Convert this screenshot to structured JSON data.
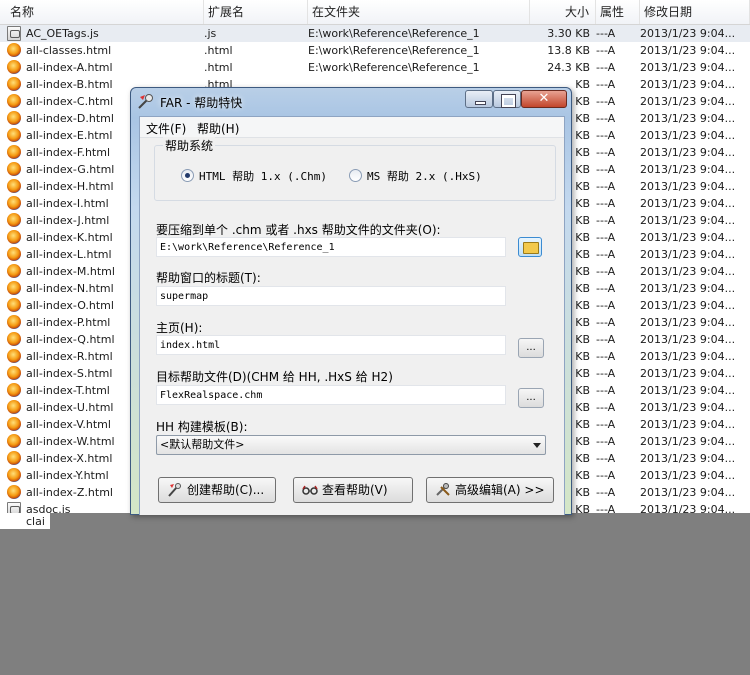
{
  "explorer": {
    "columns": {
      "name": "名称",
      "ext": "扩展名",
      "location": "在文件夹",
      "size": "大小",
      "attr": "属性",
      "date": "修改日期"
    },
    "rows": [
      {
        "name": "AC_OETags.js",
        "ext": ".js",
        "location": "E:\\work\\Reference\\Reference_1",
        "size": "3.30 KB",
        "attr": "---A",
        "date": "2013/1/23 9:04..."
      },
      {
        "name": "all-classes.html",
        "ext": ".html",
        "location": "E:\\work\\Reference\\Reference_1",
        "size": "13.8 KB",
        "attr": "---A",
        "date": "2013/1/23 9:04..."
      },
      {
        "name": "all-index-A.html",
        "ext": ".html",
        "location": "E:\\work\\Reference\\Reference_1",
        "size": "24.3 KB",
        "attr": "---A",
        "date": "2013/1/23 9:04..."
      },
      {
        "name": "all-index-B.html",
        "ext": ".html",
        "location": "",
        "size": "KB",
        "attr": "---A",
        "date": "2013/1/23 9:04..."
      },
      {
        "name": "all-index-C.html",
        "ext": "",
        "location": "",
        "size": "KB",
        "attr": "---A",
        "date": "2013/1/23 9:04..."
      },
      {
        "name": "all-index-D.html",
        "ext": "",
        "location": "",
        "size": "KB",
        "attr": "---A",
        "date": "2013/1/23 9:04..."
      },
      {
        "name": "all-index-E.html",
        "ext": "",
        "location": "",
        "size": "KB",
        "attr": "---A",
        "date": "2013/1/23 9:04..."
      },
      {
        "name": "all-index-F.html",
        "ext": "",
        "location": "",
        "size": "KB",
        "attr": "---A",
        "date": "2013/1/23 9:04..."
      },
      {
        "name": "all-index-G.html",
        "ext": "",
        "location": "",
        "size": "KB",
        "attr": "---A",
        "date": "2013/1/23 9:04..."
      },
      {
        "name": "all-index-H.html",
        "ext": "",
        "location": "",
        "size": "KB",
        "attr": "---A",
        "date": "2013/1/23 9:04..."
      },
      {
        "name": "all-index-I.html",
        "ext": "",
        "location": "",
        "size": "KB",
        "attr": "---A",
        "date": "2013/1/23 9:04..."
      },
      {
        "name": "all-index-J.html",
        "ext": "",
        "location": "",
        "size": "KB",
        "attr": "---A",
        "date": "2013/1/23 9:04..."
      },
      {
        "name": "all-index-K.html",
        "ext": "",
        "location": "",
        "size": "KB",
        "attr": "---A",
        "date": "2013/1/23 9:04..."
      },
      {
        "name": "all-index-L.html",
        "ext": "",
        "location": "",
        "size": "KB",
        "attr": "---A",
        "date": "2013/1/23 9:04..."
      },
      {
        "name": "all-index-M.html",
        "ext": "",
        "location": "",
        "size": "KB",
        "attr": "---A",
        "date": "2013/1/23 9:04..."
      },
      {
        "name": "all-index-N.html",
        "ext": "",
        "location": "",
        "size": "KB",
        "attr": "---A",
        "date": "2013/1/23 9:04..."
      },
      {
        "name": "all-index-O.html",
        "ext": "",
        "location": "",
        "size": "KB",
        "attr": "---A",
        "date": "2013/1/23 9:04..."
      },
      {
        "name": "all-index-P.html",
        "ext": "",
        "location": "",
        "size": "KB",
        "attr": "---A",
        "date": "2013/1/23 9:04..."
      },
      {
        "name": "all-index-Q.html",
        "ext": "",
        "location": "",
        "size": "KB",
        "attr": "---A",
        "date": "2013/1/23 9:04..."
      },
      {
        "name": "all-index-R.html",
        "ext": "",
        "location": "",
        "size": "KB",
        "attr": "---A",
        "date": "2013/1/23 9:04..."
      },
      {
        "name": "all-index-S.html",
        "ext": "",
        "location": "",
        "size": "KB",
        "attr": "---A",
        "date": "2013/1/23 9:04..."
      },
      {
        "name": "all-index-T.html",
        "ext": "",
        "location": "",
        "size": "KB",
        "attr": "---A",
        "date": "2013/1/23 9:04..."
      },
      {
        "name": "all-index-U.html",
        "ext": "",
        "location": "",
        "size": "KB",
        "attr": "---A",
        "date": "2013/1/23 9:04..."
      },
      {
        "name": "all-index-V.html",
        "ext": "",
        "location": "",
        "size": "KB",
        "attr": "---A",
        "date": "2013/1/23 9:04..."
      },
      {
        "name": "all-index-W.html",
        "ext": "",
        "location": "",
        "size": "KB",
        "attr": "---A",
        "date": "2013/1/23 9:04..."
      },
      {
        "name": "all-index-X.html",
        "ext": "",
        "location": "",
        "size": "KB",
        "attr": "---A",
        "date": "2013/1/23 9:04..."
      },
      {
        "name": "all-index-Y.html",
        "ext": "",
        "location": "",
        "size": "KB",
        "attr": "---A",
        "date": "2013/1/23 9:04..."
      },
      {
        "name": "all-index-Z.html",
        "ext": "",
        "location": "",
        "size": "KB",
        "attr": "---A",
        "date": "2013/1/23 9:04..."
      },
      {
        "name": "asdoc.js",
        "ext": "",
        "location": "",
        "size": "KB",
        "attr": "---A",
        "date": "2013/1/23 9:04..."
      }
    ],
    "tail_row": "clai"
  },
  "dialog": {
    "title": "FAR - 帮助特快",
    "close_label": "✕",
    "menu": {
      "file": "文件(F)",
      "help": "帮助(H)"
    },
    "help_system": {
      "label": "帮助系统",
      "option_html": "HTML 帮助 1.x (.Chm)",
      "option_ms": "MS 帮助 2.x (.HxS)"
    },
    "dir_label": "要压缩到单个 .chm 或者 .hxs 帮助文件的文件夹(O):",
    "dir_value": "E:\\work\\Reference\\Reference_1",
    "window_title_label": "帮助窗口的标题(T):",
    "window_title_value": "supermap",
    "home_label": "主页(H):",
    "home_value": "index.html",
    "target_label": "目标帮助文件(D)(CHM 给 HH, .HxS 给 H2)",
    "target_value": "FlexRealspace.chm",
    "template_label": "HH 构建模板(B):",
    "template_value": "<默认帮助文件>",
    "browse_dots": "...",
    "buttons": {
      "create": "创建帮助(C)...",
      "view": "查看帮助(V)",
      "advanced": "高级编辑(A) >>"
    }
  },
  "colors": {
    "desktop": "#7f7f7f",
    "selected_row": "#e8ecf2"
  }
}
